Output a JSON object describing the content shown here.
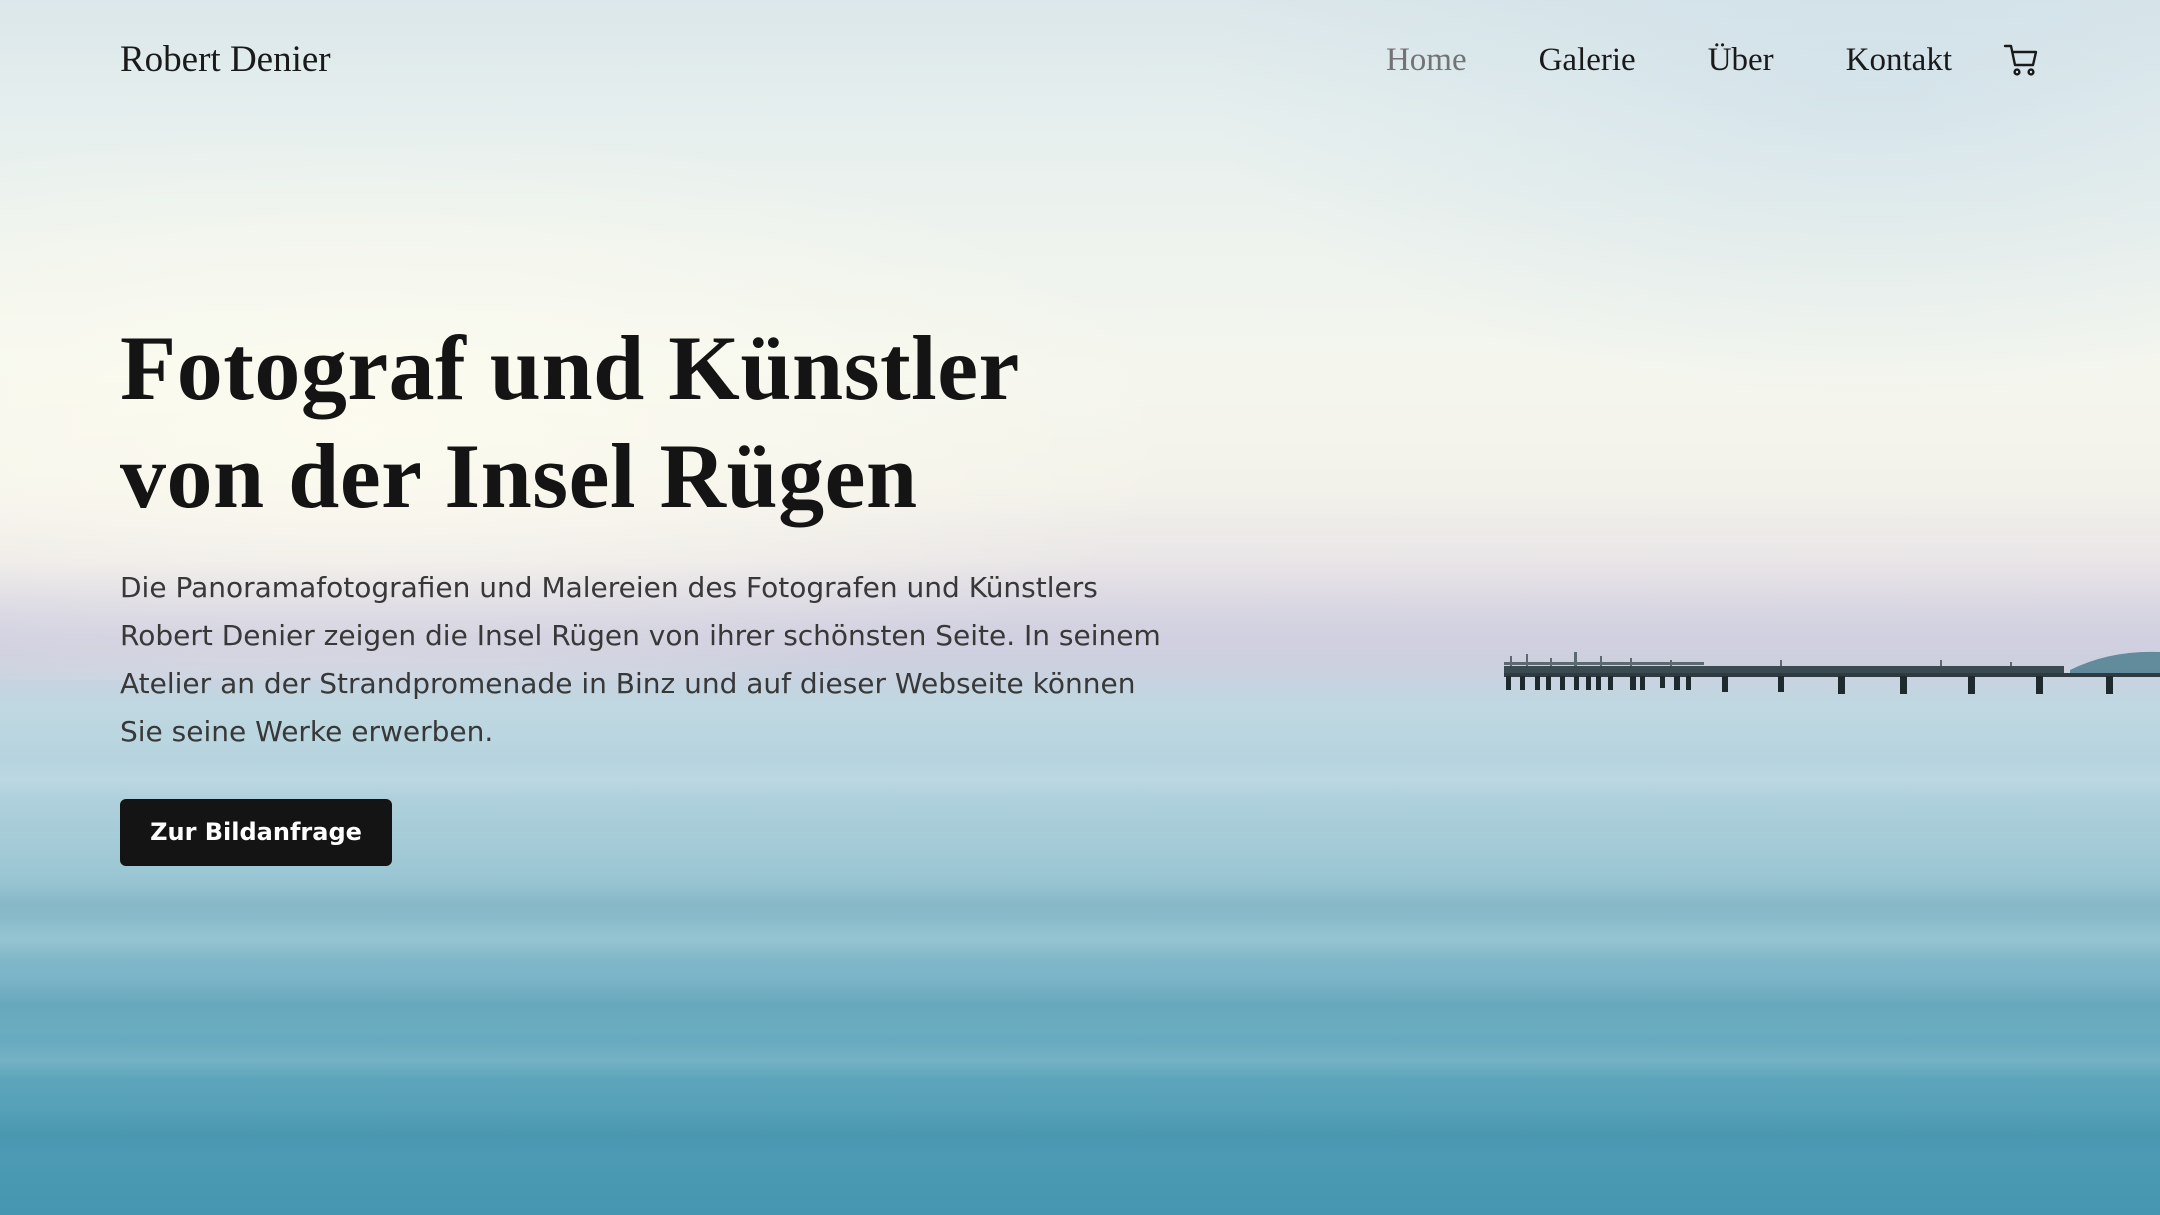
{
  "header": {
    "site_title": "Robert Denier",
    "nav": {
      "home": "Home",
      "galerie": "Galerie",
      "ueber": "Über",
      "kontakt": "Kontakt"
    },
    "active_item": "Home",
    "cart_icon": "shopping-cart-icon"
  },
  "hero": {
    "headline_line1": "Fotograf und Künstler",
    "headline_line2": "von der Insel Rügen",
    "intro_lines": [
      "Die Panoramafotografien und Malereien des Fotografen und Künstlers",
      "Robert Denier zeigen die Insel Rügen von ihrer schönsten Seite. In seinem",
      "Atelier an der Strandpromenade in Binz und auf dieser Webseite können",
      "Sie seine Werke erwerben."
    ],
    "cta_label": "Zur Bildanfrage",
    "background_image": "pier-over-calm-sea-photo"
  },
  "colors": {
    "text": "#141414",
    "nav_active": "#737373",
    "button_bg": "#141414",
    "button_text": "#ffffff",
    "sea": "#5fa6bc",
    "sky": "#eef3ee"
  }
}
